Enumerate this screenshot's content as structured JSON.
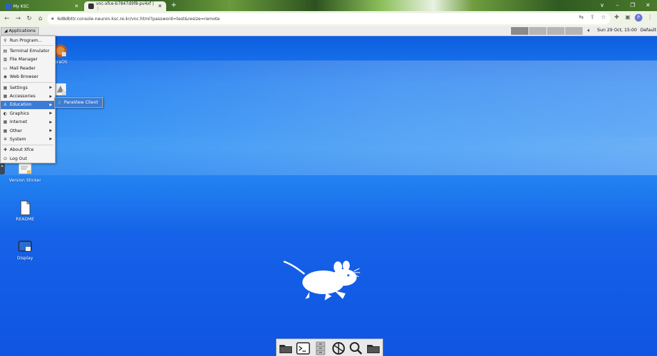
{
  "browser": {
    "tabs": [
      {
        "title": "My KSC",
        "active": false
      },
      {
        "title": "vnc-xfce-b7847d9f8-pv4xf | ⋮",
        "active": true
      }
    ],
    "new_tab_label": "+",
    "url": "6d8dbttr.console-neuron.ksc.re.kr/vnc.html?password=test&resize=remote",
    "profile_initial": "P",
    "controls": {
      "chevron": "∨",
      "minimize": "–",
      "restore": "❐",
      "close": "✕"
    }
  },
  "panel": {
    "applications_label": "Applications",
    "clock": "Sun 29 Oct, 15:00",
    "user": "Default",
    "workspaces": 4
  },
  "app_menu": {
    "items": [
      {
        "label": "Run Program...",
        "icon": "run-icon",
        "submenu": false
      },
      {
        "label": "Terminal Emulator",
        "icon": "terminal-icon",
        "submenu": false
      },
      {
        "label": "File Manager",
        "icon": "file-manager-icon",
        "submenu": false
      },
      {
        "label": "Mail Reader",
        "icon": "mail-icon",
        "submenu": false
      },
      {
        "label": "Web Browser",
        "icon": "web-icon",
        "submenu": false
      },
      {
        "label": "Settings",
        "icon": "settings-icon",
        "submenu": true
      },
      {
        "label": "Accessories",
        "icon": "accessories-icon",
        "submenu": true
      },
      {
        "label": "Education",
        "icon": "education-icon",
        "submenu": true,
        "highlighted": true
      },
      {
        "label": "Graphics",
        "icon": "graphics-icon",
        "submenu": true
      },
      {
        "label": "Internet",
        "icon": "internet-icon",
        "submenu": true
      },
      {
        "label": "Other",
        "icon": "other-icon",
        "submenu": true
      },
      {
        "label": "System",
        "icon": "system-icon",
        "submenu": true
      },
      {
        "label": "About Xfce",
        "icon": "about-icon",
        "submenu": false
      },
      {
        "label": "Log Out",
        "icon": "logout-icon",
        "submenu": false
      }
    ],
    "education_submenu": [
      {
        "label": "ParaView Client",
        "icon": "paraview-icon",
        "highlighted": true
      }
    ]
  },
  "desktop_icons": [
    {
      "label": "GraOS"
    },
    {
      "label": ""
    },
    {
      "label": "Version Sticker"
    },
    {
      "label": "README"
    },
    {
      "label": "Display"
    }
  ],
  "dock": [
    "folder-icon",
    "terminal-icon",
    "file-cabinet-icon",
    "web-browser-icon",
    "search-icon",
    "folder-icon"
  ],
  "colors": {
    "accent": "#3b7bd5",
    "desktop": "#1a6fe0",
    "panel": "#ececec"
  }
}
